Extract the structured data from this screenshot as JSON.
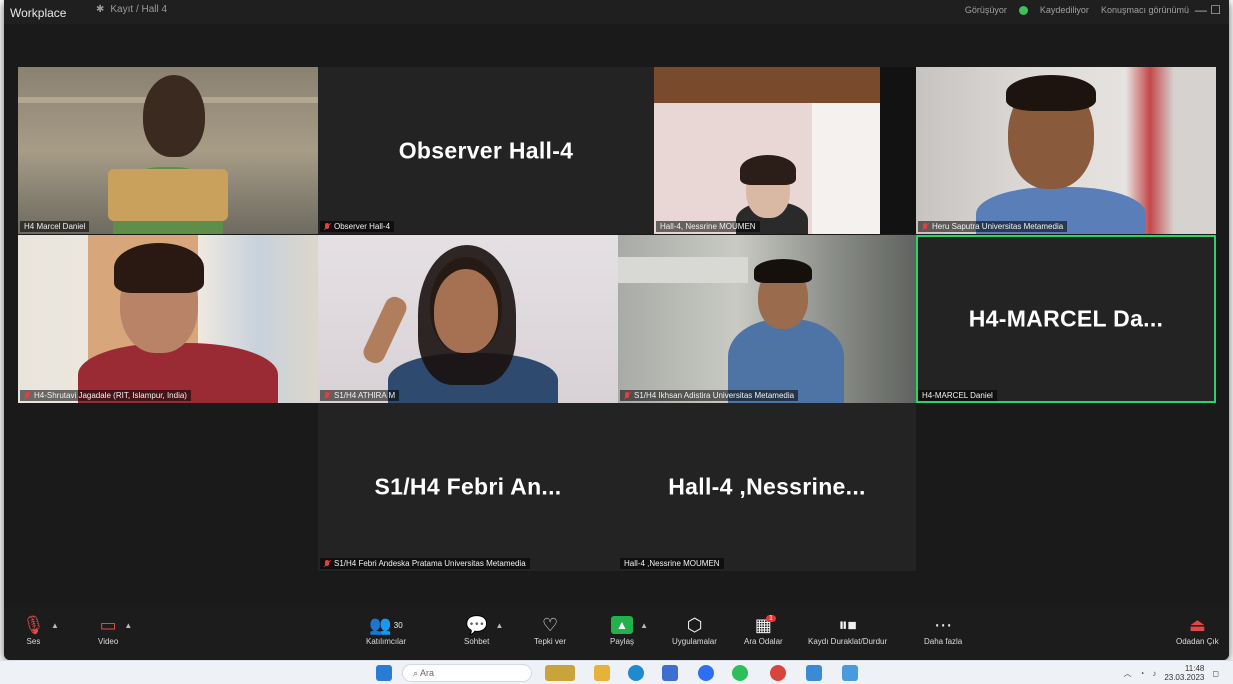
{
  "titlebar": {
    "app_name": "Workplace",
    "meeting_title": "Kayıt / Hall 4",
    "right_status": "Görüşüyor",
    "recording": "Kaydediliyor",
    "view_label": "Konuşmacı görünümü",
    "window_controls": "— ☐"
  },
  "tiles": [
    {
      "name": "H4 Marcel Daniel",
      "muted": false
    },
    {
      "name": "Observer Hall-4",
      "big": "Observer Hall-4",
      "muted": true
    },
    {
      "name": "Hall-4, Nessrine MOUMEN",
      "muted": false
    },
    {
      "name": "Heru Saputra Universitas Metamedia",
      "muted": true
    },
    {
      "name": "H4-Shrutavi Jagadale (RIT, Islampur, India)",
      "muted": true
    },
    {
      "name": "S1/H4 ATHIRA M",
      "muted": true
    },
    {
      "name": "S1/H4 Ikhsan Adistira Universitas Metamedia",
      "muted": true
    },
    {
      "name": "H4-MARCEL Daniel",
      "big": "H4-MARCEL  Da...",
      "muted": false
    },
    {
      "name": "S1/H4 Febri Andeska Pratama Universitas Metamedia",
      "big": "S1/H4  Febri  An...",
      "muted": true
    },
    {
      "name": "Hall-4 ,Nessrine MOUMEN",
      "big": "Hall-4  ,Nessrine...",
      "muted": false
    }
  ],
  "toolbar": {
    "audio": "Ses",
    "video": "Video",
    "participants": "Katılımcılar",
    "participants_count": "30",
    "chat": "Sohbet",
    "react": "Tepki ver",
    "share": "Paylaş",
    "apps": "Uygulamalar",
    "breakout": "Ara Odalar",
    "breakout_badge": "1",
    "record": "Kaydı Duraklat/Durdur",
    "more": "Daha fazla",
    "leave": "Odadan Çık"
  },
  "taskbar": {
    "search_placeholder": "Ara",
    "time": "11:48",
    "date": "23.03.2023"
  },
  "colors": {
    "active_speaker": "#2fd16a",
    "tile_bg": "#232323",
    "share_green": "#22b14c"
  }
}
